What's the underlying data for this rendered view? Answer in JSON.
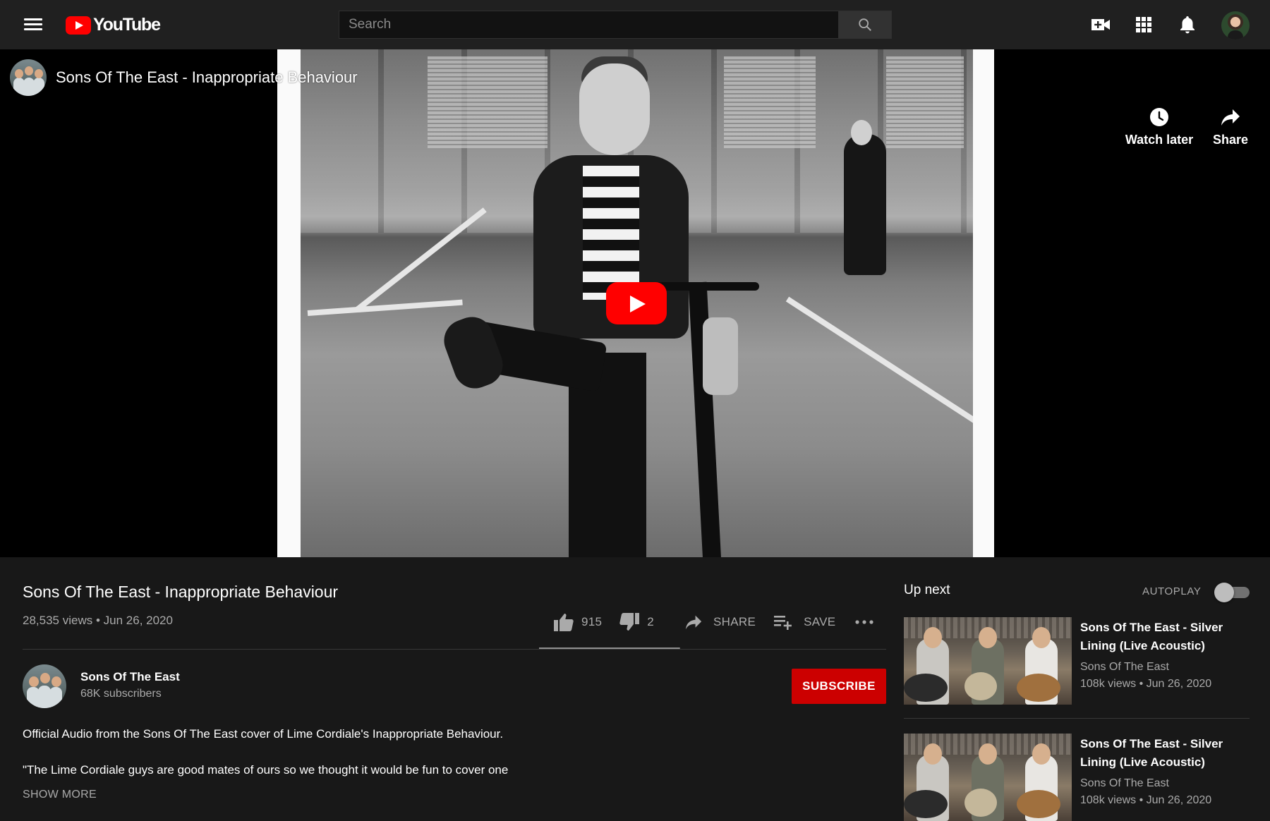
{
  "topbar": {
    "logo_text": "YouTube",
    "search_placeholder": "Search",
    "icons": [
      "menu-icon",
      "youtube-logo",
      "search-icon",
      "create-video-icon",
      "apps-grid-icon",
      "notifications-bell-icon",
      "account-avatar"
    ]
  },
  "player": {
    "title": "Sons Of The East - Inappropriate Behaviour",
    "watch_later": "Watch later",
    "share": "Share"
  },
  "video": {
    "title": "Sons Of The East - Inappropriate Behaviour",
    "views": "28,535 views",
    "date": "Jun 26, 2020",
    "likes": "915",
    "dislikes": "2",
    "like_ratio": 0.998,
    "share_label": "SHARE",
    "save_label": "SAVE"
  },
  "owner": {
    "name": "Sons Of The East",
    "subscribers": "68K subscribers",
    "subscribe_label": "SUBSCRIBE"
  },
  "description": {
    "line1": "Official Audio from the Sons Of The East cover of Lime Cordiale's Inappropriate Behaviour.",
    "line2": "\"The Lime Cordiale guys are good mates of ours so we thought it would be fun to cover one",
    "show_more": "SHOW MORE"
  },
  "upnext": {
    "title": "Up next",
    "autoplay_label": "AUTOPLAY",
    "autoplay_on": false,
    "items": [
      {
        "title": "Sons Of The East - Silver Lining (Live Acoustic)",
        "channel": "Sons Of The East",
        "views": "108k views",
        "date": "Jun 26, 2020"
      },
      {
        "title": "Sons Of The East - Silver Lining (Live Acoustic)",
        "channel": "Sons Of The East",
        "views": "108k views",
        "date": "Jun 26, 2020"
      }
    ]
  },
  "colors": {
    "background": "#181818",
    "topbar": "#202020",
    "brand_red": "#ff0000",
    "subscribe_red": "#cc0000",
    "secondary_text": "#aaaaaa"
  }
}
